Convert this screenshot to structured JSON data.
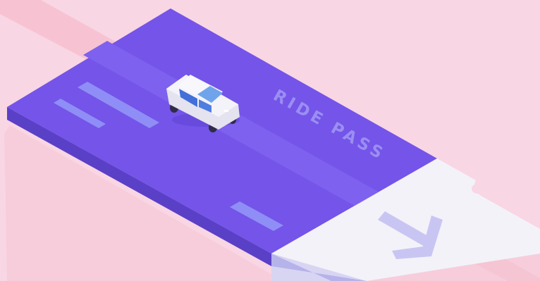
{
  "illustration": {
    "label": "RIDE PASS",
    "icon": "arrow-down-right-icon"
  },
  "colors": {
    "background": "#f9d6e3",
    "background_stripe": "#f7c4d4",
    "ticket_top": "#7454e9",
    "ticket_side": "#5a40c7",
    "road_stripe": "#7e61ee",
    "lane_markings": "#8f8ef6",
    "label_text": "#9b8ef2",
    "stub_top": "#f3f2f9",
    "stub_side": "#b6b2ea",
    "arrow": "#c9c5f3",
    "car_body": "#f4f3fa",
    "car_window": "#6fa4ec",
    "car_side_window": "#4270d8",
    "wheel": "#2f2d47"
  }
}
